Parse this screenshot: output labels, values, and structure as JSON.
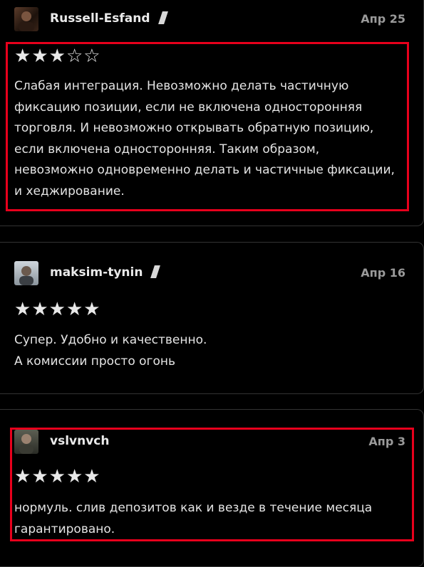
{
  "reviews": [
    {
      "author": "Russell-Esfand",
      "date": "Апр 25",
      "rating": 3,
      "text_lines": [
        "Слабая интеграция. Невозможно делать частичную",
        "фиксацию позиции, если не включена односторонняя",
        "торговля. И невозможно открывать обратную позицию,",
        "если включена односторонняя. Таким образом,",
        "невозможно одновременно делать и частичные фиксации,",
        "и хеджирование."
      ]
    },
    {
      "author": "maksim-tynin",
      "date": "Апр 16",
      "rating": 5,
      "text_lines": [
        "Супер. Удобно и качественно.",
        "А комиссии просто огонь"
      ]
    },
    {
      "author": "vslvnvch",
      "date": "Апр 3",
      "rating": 5,
      "text_lines": [
        "нормуль. слив депозитов как и везде в течение месяца",
        "гарантировано."
      ]
    }
  ],
  "colors": {
    "background": "#000000",
    "highlight": "#e8001c",
    "star": "#e8e8e8",
    "date": "#9a9a9a"
  }
}
